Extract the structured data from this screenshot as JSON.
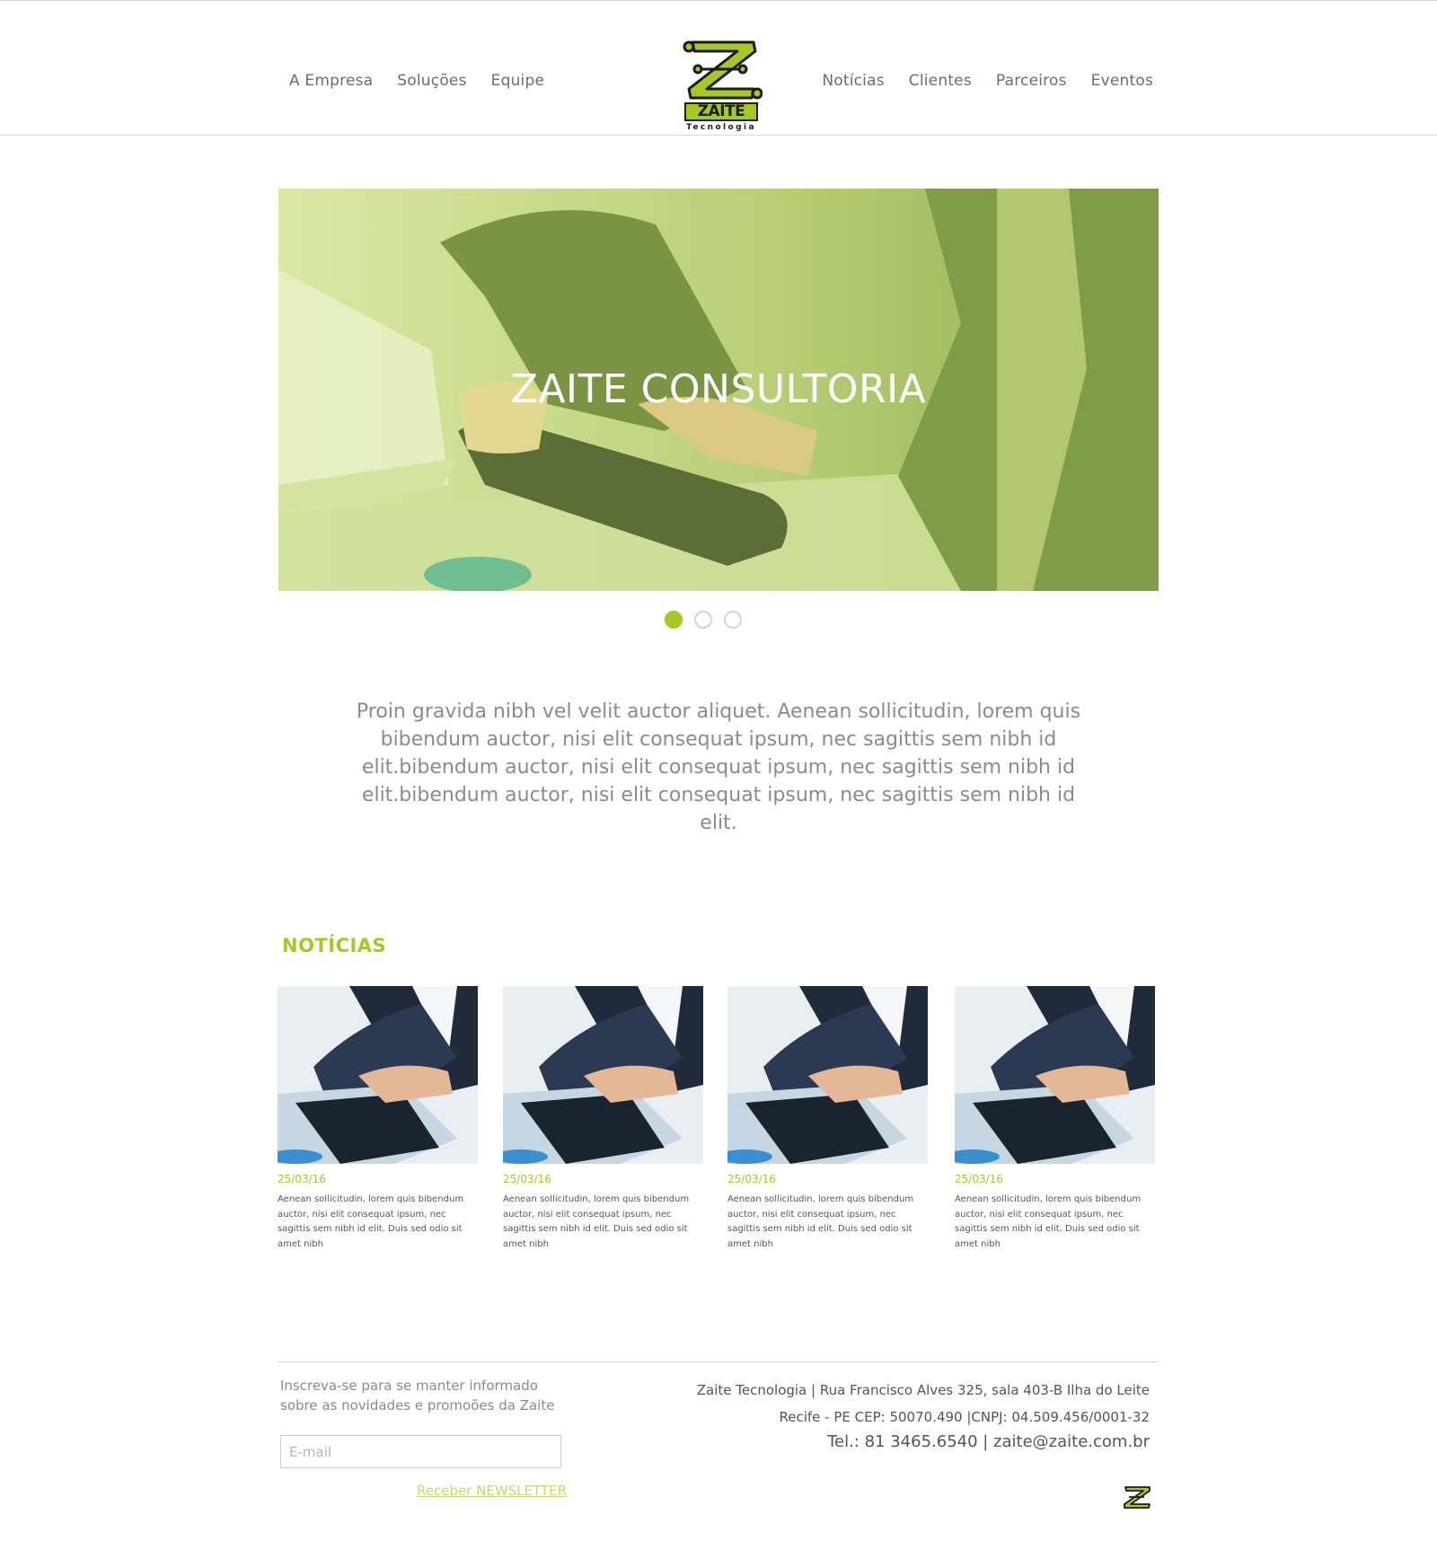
{
  "nav": {
    "left": [
      "A Empresa",
      "Soluções",
      "Equipe"
    ],
    "right": [
      "Notícias",
      "Clientes",
      "Parceiros",
      "Eventos"
    ]
  },
  "logo": {
    "word": "ZAITE",
    "sub": "Tecnologia"
  },
  "hero": {
    "title": "ZAITE CONSULTORIA",
    "slide_count": 3,
    "active_slide": 1
  },
  "intro": {
    "text": "Proin gravida nibh vel velit auctor aliquet. Aenean sollicitudin, lorem quis bibendum auctor, nisi elit consequat ipsum, nec sagittis sem nibh id elit.bibendum auctor, nisi elit consequat ipsum, nec sagittis sem nibh id elit.bibendum auctor, nisi elit consequat ipsum, nec sagittis sem nibh id elit."
  },
  "news": {
    "title": "NOTÍCIAS",
    "items": [
      {
        "date": "25/03/16",
        "text": "Aenean sollicitudin, lorem quis bibendum auctor, nisi elit consequat ipsum, nec sagittis sem nibh id elit. Duis sed odio sit amet nibh"
      },
      {
        "date": "25/03/16",
        "text": "Aenean sollicitudin, lorem quis bibendum auctor, nisi elit consequat ipsum, nec sagittis sem nibh id elit. Duis sed odio sit amet nibh"
      },
      {
        "date": "25/03/16",
        "text": "Aenean sollicitudin, lorem quis bibendum auctor, nisi elit consequat ipsum, nec sagittis sem nibh id elit. Duis sed odio sit amet nibh"
      },
      {
        "date": "25/03/16",
        "text": "Aenean sollicitudin, lorem quis bibendum auctor, nisi elit consequat ipsum, nec sagittis sem nibh id elit. Duis sed odio sit amet nibh"
      }
    ]
  },
  "footer": {
    "subscribe_text": "Inscreva-se para se manter informado sobre as novidades e promoões da Zaite",
    "email_placeholder": "E-mail",
    "newsletter_label": "Receber NEWSLETTER",
    "address_line1": "Zaite Tecnologia | Rua Francisco Alves 325, sala 403-B Ilha do Leite",
    "address_line2": "Recife - PE CEP: 50070.490 |CNPJ: 04.509.456/0001-32",
    "address_line3": "Tel.: 81 3465.6540 | zaite@zaite.com.br"
  },
  "colors": {
    "accent": "#a6c827",
    "text": "#6d6d6d",
    "muted": "#8b8b8b",
    "link_light": "#c5d96d"
  },
  "icons": [
    "zaite-logo-icon",
    "zaite-small-logo-icon"
  ]
}
